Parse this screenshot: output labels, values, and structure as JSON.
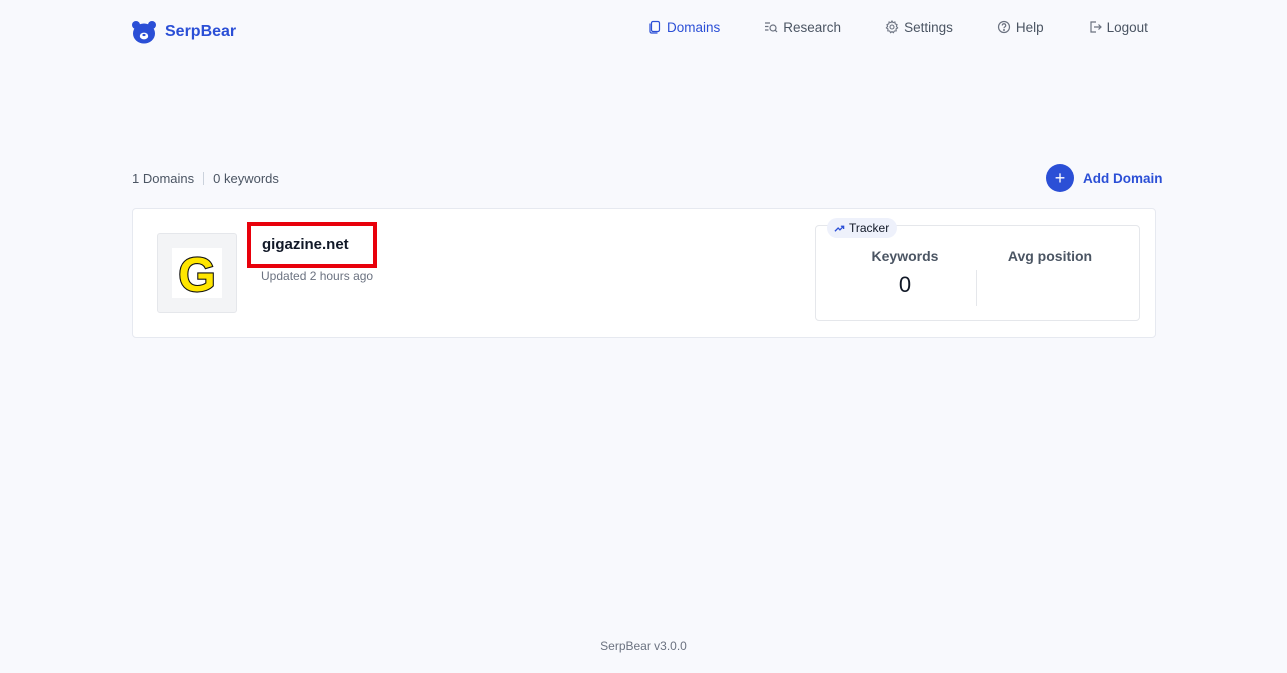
{
  "app": {
    "name": "SerpBear",
    "version_text": "SerpBear v3.0.0"
  },
  "nav": {
    "items": [
      {
        "label": "Domains",
        "icon": "domains-icon",
        "active": true
      },
      {
        "label": "Research",
        "icon": "research-icon",
        "active": false
      },
      {
        "label": "Settings",
        "icon": "gear-icon",
        "active": false
      },
      {
        "label": "Help",
        "icon": "help-icon",
        "active": false
      },
      {
        "label": "Logout",
        "icon": "logout-icon",
        "active": false
      }
    ]
  },
  "summary": {
    "domains": "1 Domains",
    "keywords": "0 keywords"
  },
  "actions": {
    "add_domain_label": "Add Domain",
    "add_icon": "+"
  },
  "domains": [
    {
      "name": "gigazine.net",
      "updated": "Updated 2 hours ago",
      "favicon_letter": "G",
      "tracker": {
        "badge_label": "Tracker",
        "keywords_label": "Keywords",
        "keywords_value": "0",
        "avg_position_label": "Avg position",
        "avg_position_value": ""
      }
    }
  ],
  "colors": {
    "accent": "#2b4fd6",
    "highlight_border": "#e8000b",
    "background": "#f8f9fd",
    "favicon_yellow": "#ffe600"
  }
}
